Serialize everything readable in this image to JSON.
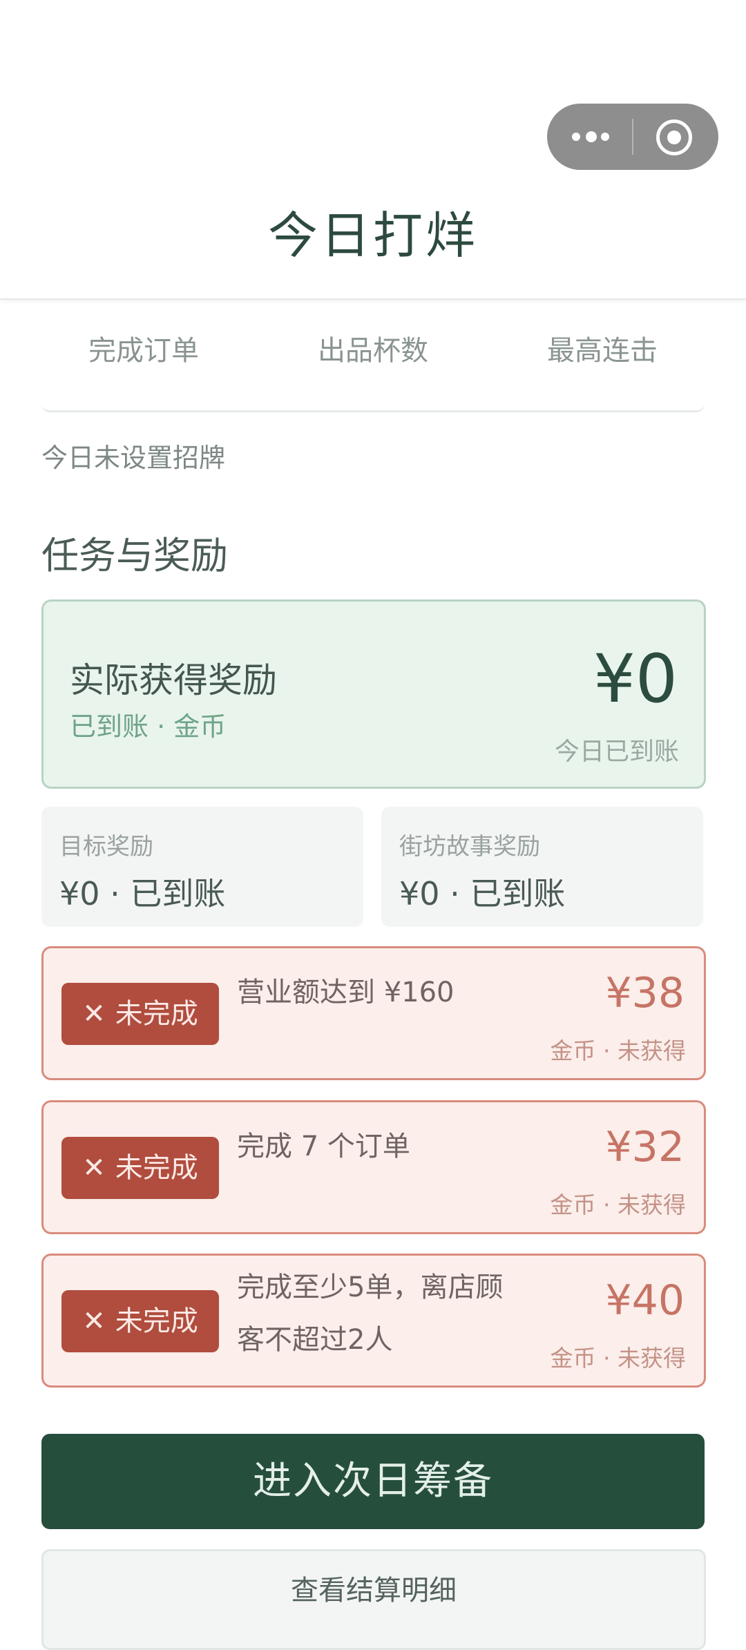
{
  "header": {
    "title": "今日打烊"
  },
  "stats": {
    "labels": [
      "完成订单",
      "出品杯数",
      "最高连击"
    ]
  },
  "signature_note": "今日未设置招牌",
  "section_title": "任务与奖励",
  "reward": {
    "title": "实际获得奖励",
    "sub": "已到账 · 金币",
    "amount": "¥0",
    "note": "今日已到账"
  },
  "sub_rewards": [
    {
      "label": "目标奖励",
      "value": "¥0 · 已到账"
    },
    {
      "label": "街坊故事奖励",
      "value": "¥0 · 已到账"
    }
  ],
  "tasks": [
    {
      "status": "未完成",
      "text": "营业额达到 ¥160",
      "amount": "¥38",
      "note": "金币 · 未获得"
    },
    {
      "status": "未完成",
      "text": "完成 7 个订单",
      "amount": "¥32",
      "note": "金币 · 未获得"
    },
    {
      "status": "未完成",
      "text": "完成至少5单，离店顾客不超过2人",
      "amount": "¥40",
      "note": "金币 · 未获得"
    }
  ],
  "buttons": {
    "primary": "进入次日筹备",
    "secondary": "查看结算明细"
  },
  "colors": {
    "brand_green": "#264e3d",
    "fail_red": "#b04d3e",
    "reward_bg": "#e8f4ec"
  }
}
